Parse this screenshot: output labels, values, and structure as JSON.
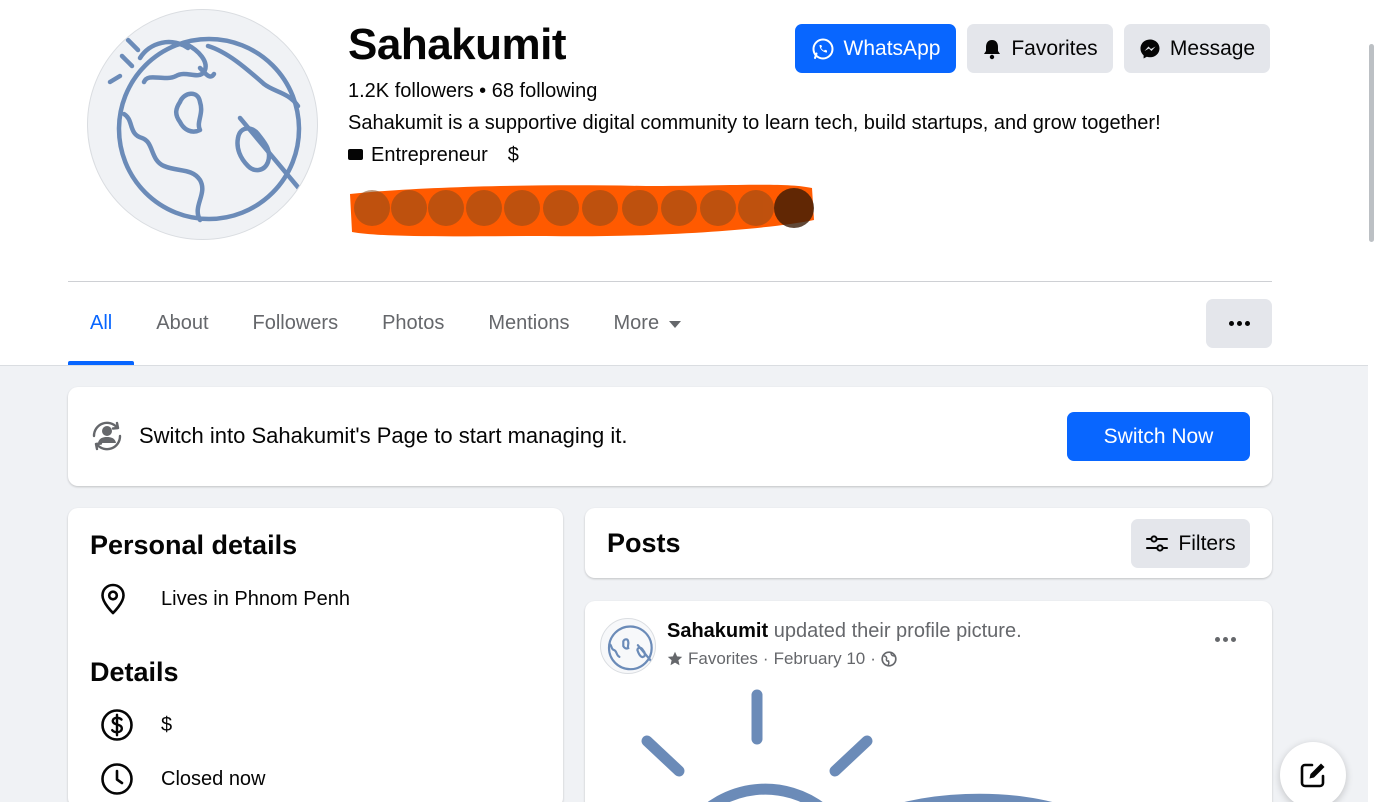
{
  "profile": {
    "name": "Sahakumit",
    "follow_counts": "1.2K followers • 68 following",
    "bio": "Sahakumit is a supportive digital community to learn tech, build startups, and grow together!",
    "category": "Entrepreneur",
    "price": "$"
  },
  "actions": {
    "whatsapp_label": "WhatsApp",
    "favorites_label": "Favorites",
    "message_label": "Message"
  },
  "tabs": [
    {
      "label": "All",
      "active": true
    },
    {
      "label": "About"
    },
    {
      "label": "Followers"
    },
    {
      "label": "Photos"
    },
    {
      "label": "Mentions"
    },
    {
      "label": "More"
    }
  ],
  "switch_banner": {
    "text": "Switch into Sahakumit's Page to start managing it.",
    "button_label": "Switch Now"
  },
  "personal_details": {
    "title": "Personal details",
    "lives_in": "Lives in Phnom Penh"
  },
  "details": {
    "title": "Details",
    "price": "$",
    "hours": "Closed now"
  },
  "posts": {
    "title": "Posts",
    "filters_label": "Filters"
  },
  "post": {
    "author": "Sahakumit",
    "action": "updated their profile picture.",
    "audience": "Favorites",
    "date": "February 10",
    "separator": "·"
  },
  "colors": {
    "accent": "#0866ff",
    "globe_blue": "#6b8bb8",
    "redaction": "#ff5a00",
    "secondary_text": "#65676b",
    "button_gray": "#e4e6eb",
    "page_bg": "#f0f2f5"
  },
  "icons": {
    "whatsapp": "whatsapp-icon",
    "favorites": "bell-icon",
    "message": "messenger-icon",
    "category": "briefcase-icon",
    "switch": "profile-switch-icon",
    "location": "location-pin-icon",
    "price": "dollar-circle-icon",
    "hours": "clock-icon",
    "filters": "sliders-icon",
    "audience_star": "star-icon",
    "privacy": "globe-icon",
    "compose": "compose-icon"
  }
}
